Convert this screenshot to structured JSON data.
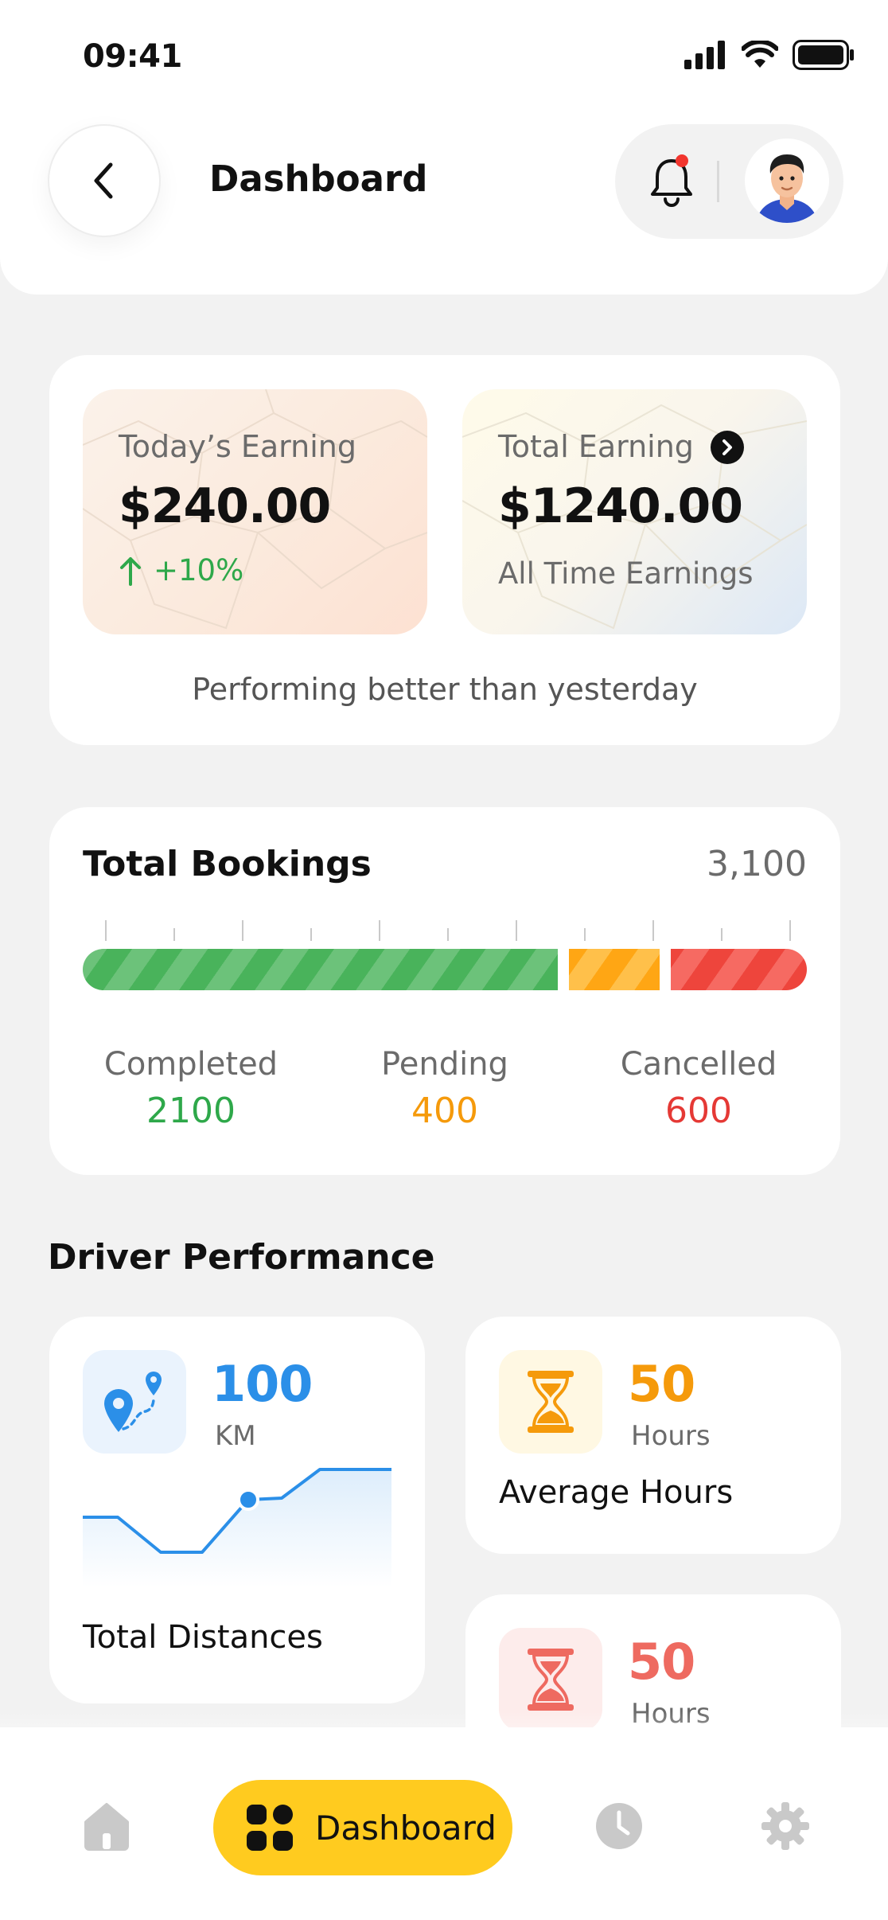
{
  "status_bar": {
    "time": "09:41"
  },
  "header": {
    "title": "Dashboard"
  },
  "earnings": {
    "today": {
      "label": "Today’s Earning",
      "value": "$240.00",
      "trend": "+10%"
    },
    "total": {
      "label": "Total Earning",
      "value": "$1240.00",
      "sub": "All Time Earnings"
    },
    "caption": "Performing better than yesterday"
  },
  "bookings": {
    "title": "Total Bookings",
    "total": "3,100",
    "completed": {
      "label": "Completed",
      "value": "2100",
      "color": "#2EA84A"
    },
    "pending": {
      "label": "Pending",
      "value": "400",
      "color": "#F59A0B"
    },
    "cancelled": {
      "label": "Cancelled",
      "value": "600",
      "color": "#E53935"
    }
  },
  "performance": {
    "title": "Driver Performance",
    "distance": {
      "value": "100",
      "unit": "KM",
      "label": "Total Distances",
      "accent": "#2B8FE8"
    },
    "average": {
      "value": "50",
      "unit": "Hours",
      "label": "Average Hours",
      "accent": "#F59A0B"
    },
    "second": {
      "value": "50",
      "unit": "Hours",
      "accent": "#EE6A60"
    }
  },
  "nav": {
    "active_label": "Dashboard",
    "accent": "#FFCB1F"
  },
  "icons": [
    "back-icon",
    "bell-icon",
    "avatar",
    "chevron-right-icon",
    "arrow-up-icon",
    "map-pin-route-icon",
    "hourglass-icon",
    "home-icon",
    "dashboard-grid-icon",
    "clock-icon",
    "gear-icon"
  ]
}
